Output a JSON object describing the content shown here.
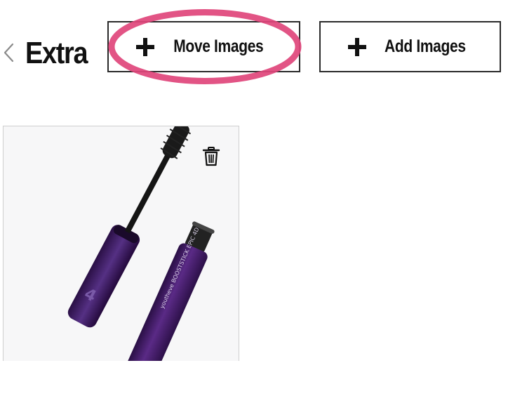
{
  "header": {
    "title": "Extra",
    "back_icon": "chevron-left-icon"
  },
  "toolbar": {
    "move_label": "Move Images",
    "add_label": "Add Images",
    "plus_icon": "plus-icon",
    "highlight_color": "#e0457b"
  },
  "gallery": {
    "items": [
      {
        "product_text": "youtheve BOOSTSTICK EPIC 4D",
        "delete_icon": "trash-icon",
        "product_color": "#4a1f6e"
      }
    ]
  }
}
